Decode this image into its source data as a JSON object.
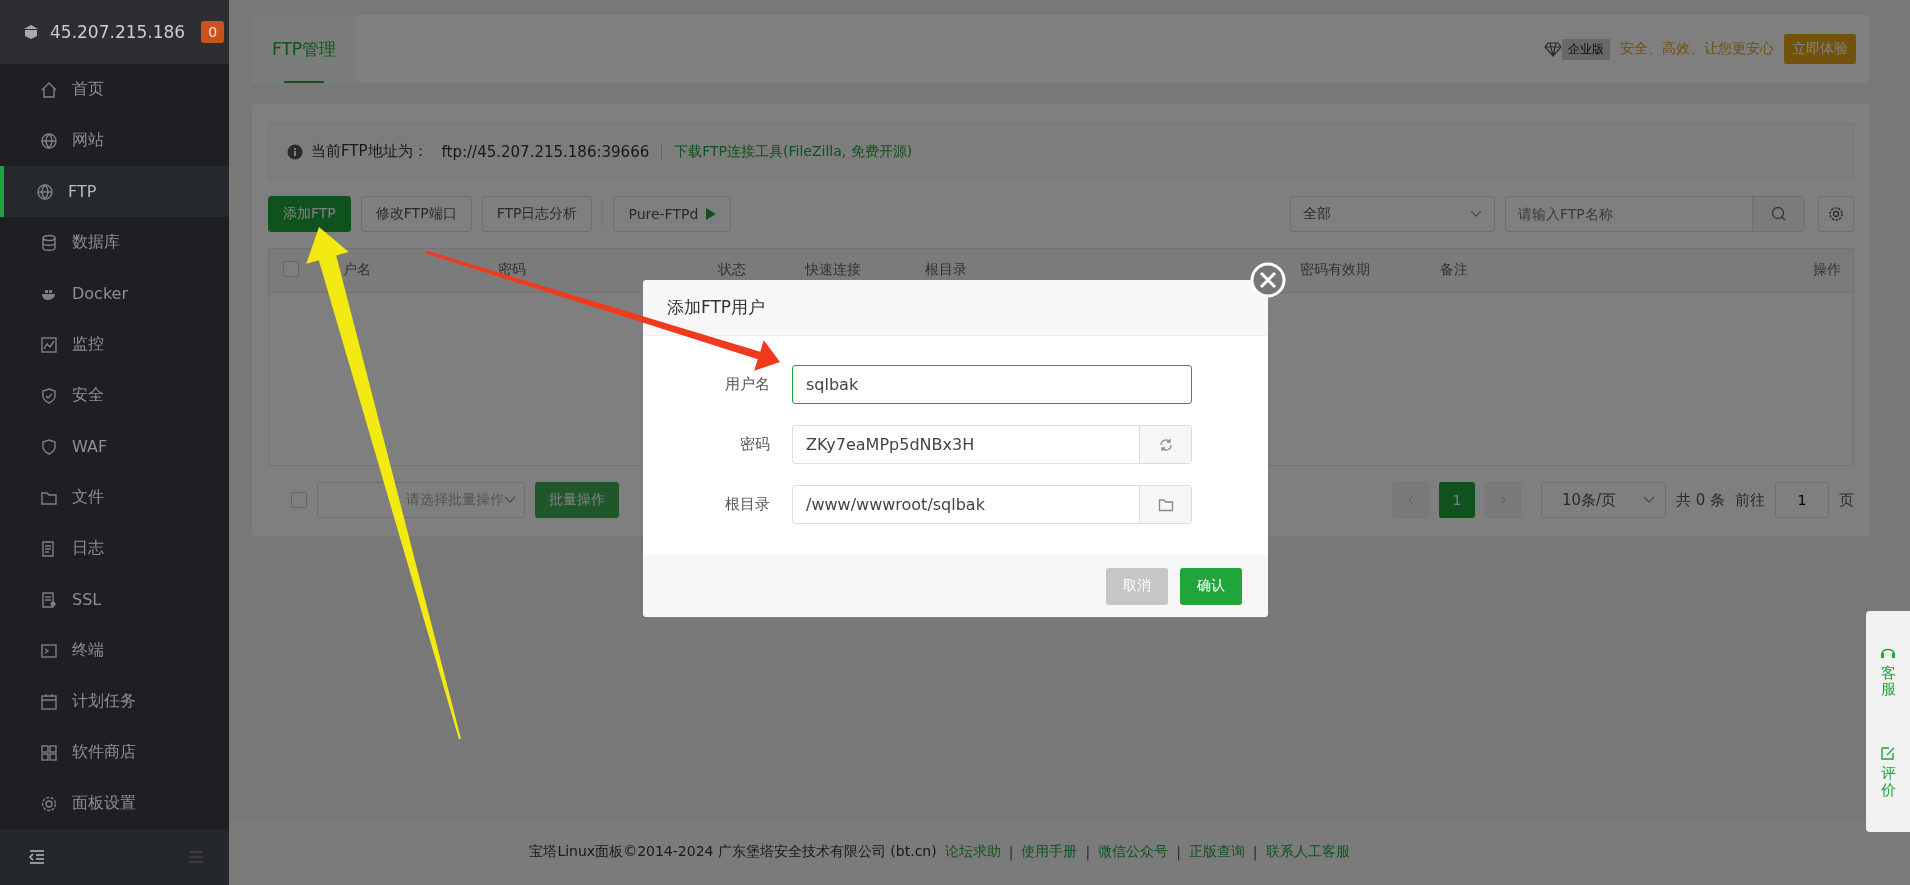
{
  "sidebar": {
    "server": "45.207.215.186",
    "badge": "0",
    "items": [
      {
        "label": "首页",
        "selected": false
      },
      {
        "label": "网站",
        "selected": false
      },
      {
        "label": "FTP",
        "selected": true
      },
      {
        "label": "数据库",
        "selected": false
      },
      {
        "label": "Docker",
        "selected": false
      },
      {
        "label": "监控",
        "selected": false
      },
      {
        "label": "安全",
        "selected": false
      },
      {
        "label": "WAF",
        "selected": false
      },
      {
        "label": "文件",
        "selected": false
      },
      {
        "label": "日志",
        "selected": false
      },
      {
        "label": "SSL",
        "selected": false
      },
      {
        "label": "终端",
        "selected": false
      },
      {
        "label": "计划任务",
        "selected": false
      },
      {
        "label": "软件商店",
        "selected": false
      },
      {
        "label": "面板设置",
        "selected": false
      }
    ]
  },
  "tabs": [
    {
      "label": "FTP管理",
      "selected": true
    }
  ],
  "promo": {
    "edition": "企业版",
    "slogan": "安全、高效、让您更安心",
    "button": "立即体验"
  },
  "info": {
    "label": "当前FTP地址为：",
    "address": "ftp://45.207.215.186:39666",
    "link": "下载FTP连接工具(FileZilla, 免费开源)"
  },
  "toolbar": {
    "buttons": [
      {
        "label": "添加FTP",
        "kind": "primary"
      },
      {
        "label": "修改FTP端口",
        "kind": "default"
      },
      {
        "label": "FTP日志分析",
        "kind": "default"
      },
      {
        "label": "Pure-FTPd",
        "kind": "service"
      }
    ],
    "filter": "全部",
    "search_placeholder": "请输入FTP名称"
  },
  "table": {
    "select_all": {
      "checked": false
    },
    "columns": [
      "户名",
      "密码",
      "状态",
      "快速连接",
      "根目录",
      "密码有效期",
      "备注",
      "操作"
    ]
  },
  "batch": {
    "checked": false,
    "placeholder": "请选择批量操作",
    "button": "批量操作"
  },
  "pagination": {
    "pages": [
      {
        "label": "1",
        "selected": true
      }
    ],
    "page_size": "10条/页",
    "total": "共 0 条",
    "goto_label": "前往",
    "goto_value": "1",
    "goto_suffix": "页"
  },
  "footer": {
    "copyright": "宝塔Linux面板©2014-2024 广东堡塔安全技术有限公司 (bt.cn)",
    "separator": "|",
    "links": [
      "论坛求助",
      "使用手册",
      "微信公众号",
      "正版查询",
      "联系人工客服"
    ]
  },
  "float_menu": [
    {
      "label": "客服"
    },
    {
      "label": "评价"
    }
  ],
  "dialog": {
    "title": "添加FTP用户",
    "fields": [
      {
        "label": "用户名",
        "value": "sqlbak",
        "kind": "text",
        "focused": true
      },
      {
        "label": "密码",
        "value": "ZKy7eaMPp5dNBx3H",
        "kind": "refresh",
        "focused": false
      },
      {
        "label": "根目录",
        "value": "/www/wwwroot/sqlbak",
        "kind": "folder",
        "focused": false
      }
    ],
    "buttons": [
      {
        "label": "取消",
        "kind": "cancel"
      },
      {
        "label": "确认",
        "kind": "confirm"
      }
    ]
  },
  "annotations": [
    {
      "kind": "arrow",
      "color": "#f03a1e"
    },
    {
      "kind": "arrow",
      "color": "#f3ea12"
    }
  ]
}
